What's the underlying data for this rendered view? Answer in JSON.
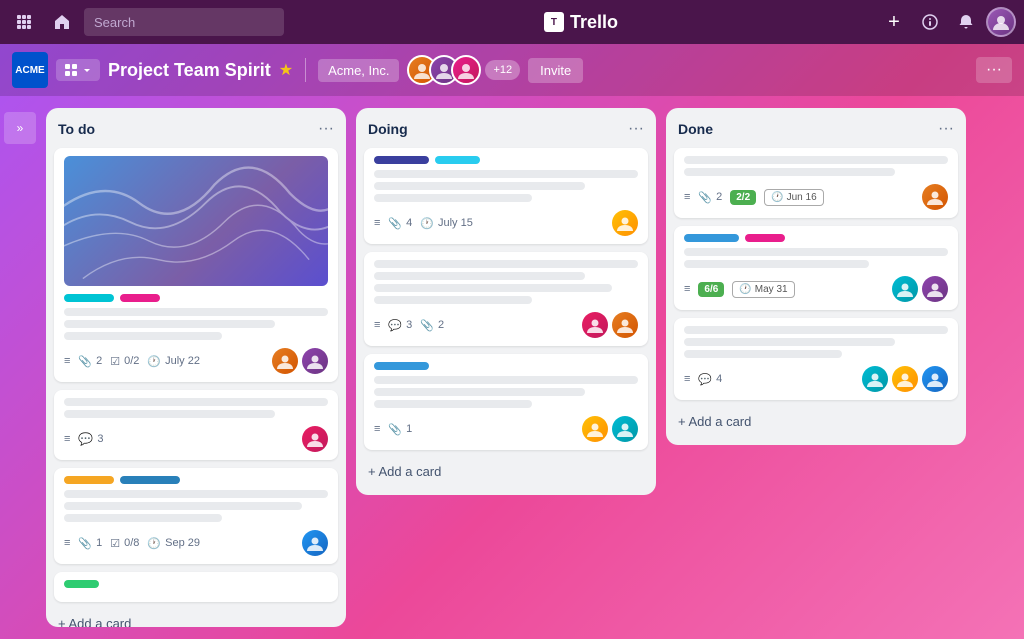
{
  "topNav": {
    "searchPlaceholder": "Search",
    "logoText": "Trello",
    "addLabel": "+",
    "infoLabel": "ℹ",
    "bellLabel": "🔔"
  },
  "boardHeader": {
    "logoText": "ACME",
    "menuLabel": "⊞",
    "title": "Project Team Spirit",
    "starLabel": "★",
    "workspaceLabel": "Acme, Inc.",
    "memberCount": "+12",
    "inviteLabel": "Invite",
    "moreLabel": "···"
  },
  "sidebarToggle": "»",
  "columns": [
    {
      "id": "todo",
      "title": "To do",
      "moreLabel": "···",
      "cards": [
        {
          "id": "todo-1",
          "hasImage": true,
          "tags": [
            "cyan",
            "pink"
          ],
          "lines": [
            "full",
            "w80",
            "w60"
          ],
          "footer": {
            "listIcon": "≡",
            "attachIcon": "📎",
            "attachCount": "2",
            "checkIcon": "☑",
            "checkLabel": "0/2",
            "dateIcon": "🕐",
            "dateLabel": "July 22"
          },
          "avatars": [
            "orange",
            "purple"
          ]
        },
        {
          "id": "todo-2",
          "tags": [],
          "lines": [
            "full",
            "w80"
          ],
          "footer": {
            "listIcon": "≡",
            "commentIcon": "💬",
            "commentCount": "3"
          },
          "avatars": [
            "pink"
          ]
        },
        {
          "id": "todo-3",
          "tags": [
            "yellow",
            "blue-med"
          ],
          "lines": [
            "full",
            "w90",
            "w60"
          ],
          "footer": {
            "listIcon": "≡",
            "attachIcon": "📎",
            "attachCount": "1",
            "checkIcon": "☑",
            "checkLabel": "0/8",
            "dateIcon": "🕐",
            "dateLabel": "Sep 29"
          },
          "avatars": [
            "blue"
          ]
        },
        {
          "id": "todo-4",
          "tags": [
            "green"
          ],
          "lines": [],
          "footer": {}
        }
      ],
      "addLabel": "+ Add a card"
    },
    {
      "id": "doing",
      "title": "Doing",
      "moreLabel": "···",
      "cards": [
        {
          "id": "doing-1",
          "hasColorTags": true,
          "lines": [
            "full",
            "w80",
            "w60"
          ],
          "footer": {
            "listIcon": "≡",
            "attachIcon": "📎",
            "attachCount": "4",
            "dateIcon": "🕐",
            "dateLabel": "July 15"
          },
          "avatars": [
            "yellow"
          ]
        },
        {
          "id": "doing-2",
          "lines": [
            "full",
            "w80",
            "w90",
            "w60"
          ],
          "footer": {
            "listIcon": "≡",
            "commentIcon": "💬",
            "commentCount": "3",
            "attachIcon": "📎",
            "attachCount": "2"
          },
          "avatars": [
            "pink",
            "orange"
          ]
        },
        {
          "id": "doing-3",
          "hasSingleTag": true,
          "lines": [
            "full",
            "w80",
            "w60"
          ],
          "footer": {
            "listIcon": "≡",
            "attachIcon": "📎",
            "attachCount": "1"
          },
          "avatars": [
            "yellow",
            "teal"
          ]
        }
      ],
      "addLabel": "+ Add a card"
    },
    {
      "id": "done",
      "title": "Done",
      "moreLabel": "···",
      "cards": [
        {
          "id": "done-1",
          "lines": [
            "full",
            "w80"
          ],
          "footer": {
            "listIcon": "≡",
            "attachCount": "2",
            "checkBadge": "2/2",
            "dateBadge": "Jun 16"
          },
          "avatars": [
            "orange"
          ]
        },
        {
          "id": "done-2",
          "tags": [
            "blue2",
            "hot-pink"
          ],
          "lines": [
            "full",
            "w70"
          ],
          "footer": {
            "listIcon": "≡",
            "checkBadge": "6/6",
            "dateBadge": "May 31"
          },
          "avatars": [
            "teal",
            "purple"
          ]
        },
        {
          "id": "done-3",
          "lines": [
            "full",
            "w80",
            "w60"
          ],
          "footer": {
            "listIcon": "≡",
            "commentIcon": "💬",
            "commentCount": "4"
          },
          "avatars": [
            "teal",
            "yellow",
            "blue"
          ]
        }
      ],
      "addLabel": "+ Add a card"
    }
  ]
}
